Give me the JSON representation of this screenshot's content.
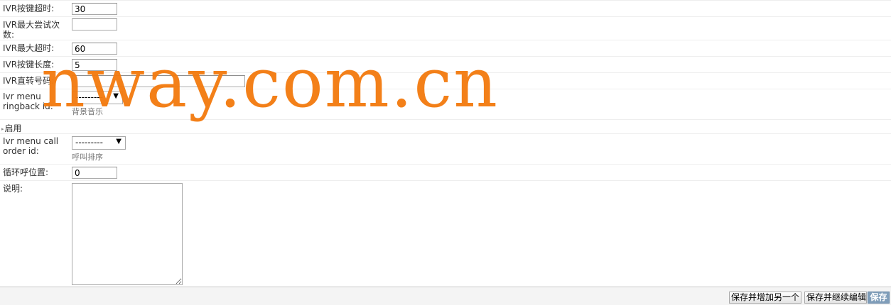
{
  "form": {
    "fields": {
      "key_timeout": {
        "label": "IVR按键超时:",
        "value": "30"
      },
      "max_attempts": {
        "label": "IVR最大尝试次数:",
        "value": ""
      },
      "max_timeout": {
        "label": "IVR最大超时:",
        "value": "60"
      },
      "key_length": {
        "label": "IVR按键长度:",
        "value": "5"
      },
      "direct_number": {
        "label": "IVR直转号码:",
        "value": ""
      },
      "ringback": {
        "label": "Ivr menu ringback id:",
        "selected": "---------",
        "help": "背景音乐"
      },
      "call_order": {
        "label": "Ivr menu call order id:",
        "selected": "---------",
        "help": "呼叫排序"
      },
      "loop_position": {
        "label": "循环呼位置:",
        "value": "0"
      },
      "description": {
        "label": "说明:",
        "value": ""
      }
    },
    "section": {
      "title": "启用",
      "toggle_icon": "triangle-right-icon"
    }
  },
  "actions": {
    "save_add_another": "保存并增加另一个",
    "save_continue": "保存并继续编辑",
    "save": "保存"
  },
  "watermark": {
    "text": "nway.com.cn",
    "color": "#f37b10"
  }
}
